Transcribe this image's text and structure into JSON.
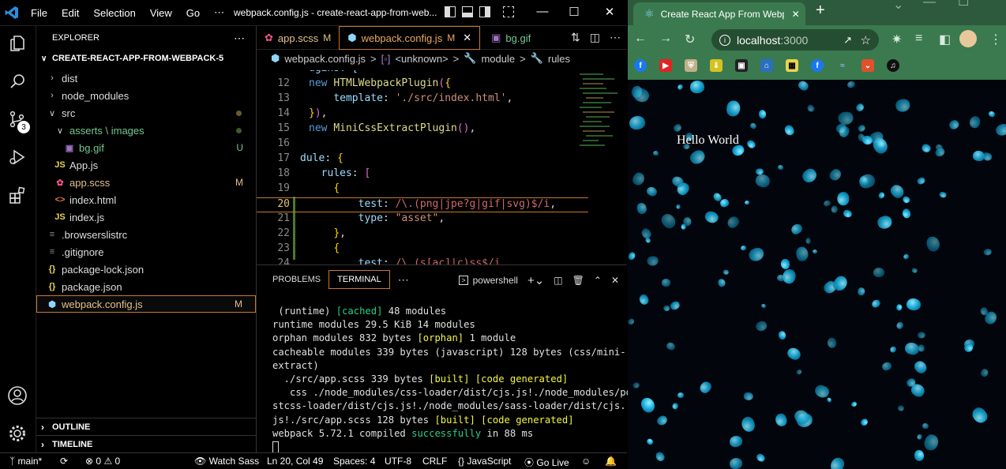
{
  "vscode": {
    "menu": [
      "File",
      "Edit",
      "Selection",
      "View",
      "Go",
      "⋯"
    ],
    "window_title": "webpack.config.js - create-react-app-from-web...",
    "sidebar": {
      "header": "EXPLORER",
      "project": "CREATE-REACT-APP-FROM-WEBPACK-5",
      "items": [
        {
          "label": "dist",
          "status": ""
        },
        {
          "label": "node_modules",
          "status": ""
        },
        {
          "label": "src",
          "status": ""
        },
        {
          "label": "asserts \\ images",
          "status": ""
        },
        {
          "label": "bg.gif",
          "status": "U"
        },
        {
          "label": "App.js",
          "status": ""
        },
        {
          "label": "app.scss",
          "status": "M"
        },
        {
          "label": "index.html",
          "status": ""
        },
        {
          "label": "index.js",
          "status": ""
        },
        {
          "label": ".browserslistrc",
          "status": ""
        },
        {
          "label": ".gitignore",
          "status": ""
        },
        {
          "label": "package-lock.json",
          "status": ""
        },
        {
          "label": "package.json",
          "status": ""
        },
        {
          "label": "webpack.config.js",
          "status": "M"
        }
      ],
      "outline": "OUTLINE",
      "timeline": "TIMELINE"
    },
    "tabs": [
      {
        "label": "app.scss",
        "mod": "M"
      },
      {
        "label": "webpack.config.js",
        "mod": "M"
      },
      {
        "label": "bg.gif",
        "mod": ""
      }
    ],
    "breadcrumbs": [
      "webpack.config.js",
      ">",
      "<unknown>",
      ">",
      "module",
      ">",
      "rules"
    ],
    "line_numbers": [
      "12",
      "13",
      "14",
      "15",
      "16",
      "17",
      "18",
      "19",
      "20",
      "21",
      "22",
      "23",
      "24"
    ],
    "panel": {
      "tabs": [
        "PROBLEMS",
        "TERMINAL"
      ],
      "more": "⋯",
      "shell": "powershell"
    },
    "terminal": {
      "l1a": " (runtime) ",
      "l1b": "[cached]",
      "l1c": " 48 modules",
      "l2": "runtime modules 29.5 KiB 14 modules",
      "l3a": "orphan modules 832 bytes ",
      "l3b": "[orphan]",
      "l3c": " 1 module",
      "l4": "cacheable modules 339 bytes (javascript) 128 bytes (css/mini-",
      "l5": "extract)",
      "l6a": "  ./src/app.scss 339 bytes ",
      "l6b": "[built]",
      "l6c": " ",
      "l6d": "[code generated]",
      "l7": "   css ./node_modules/css-loader/dist/cjs.js!./node_modules/po",
      "l8": "stcss-loader/dist/cjs.js!./node_modules/sass-loader/dist/cjs.",
      "l9a": "js!./src/app.scss 128 bytes ",
      "l9b": "[built]",
      "l9c": " ",
      "l9d": "[code generated]",
      "l10a": "webpack 5.72.1 compiled ",
      "l10b": "successfully",
      "l10c": " in 88 ms"
    },
    "status": {
      "branch": "main*",
      "errors": "0",
      "warnings": "0",
      "watch": "Watch Sass",
      "position": "Ln 20, Col 49",
      "spaces": "Spaces: 4",
      "encoding": "UTF-8",
      "eol": "CRLF",
      "language": "JavaScript",
      "golive": "Go Live"
    },
    "activity_badge": "3"
  },
  "chrome": {
    "tab_title": "Create React App From Webp",
    "url_host": "localhost",
    "url_port": ":3000",
    "page_text": "Hello World",
    "colors": {
      "frame": "#2d5a3c",
      "toolbar": "#3a7a4e",
      "omnibox": "#254d32"
    }
  }
}
